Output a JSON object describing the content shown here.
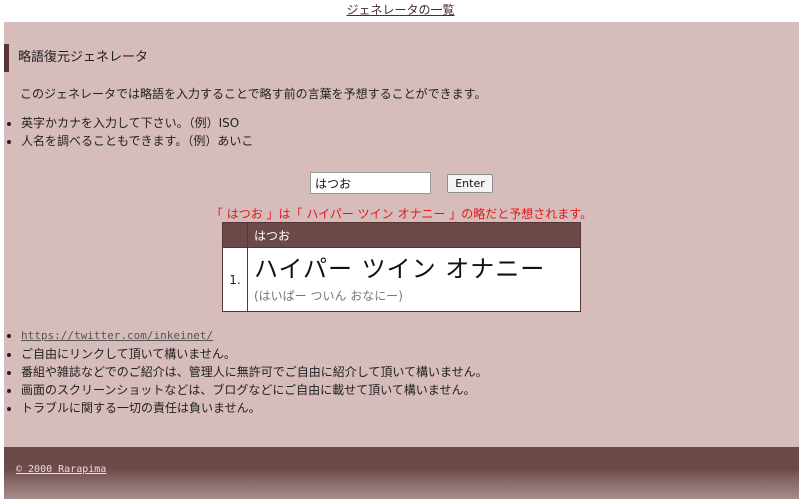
{
  "header": {
    "generator_list_link": "ジェネレータの一覧"
  },
  "page": {
    "title": "略語復元ジェネレータ",
    "intro": "このジェネレータでは略語を入力することで略す前の言葉を予想することができます。",
    "tips": [
      "英字かカナを入力して下さい。（例）ISO",
      "人名を調べることもできます。（例）あいこ"
    ]
  },
  "form": {
    "query_value": "はつお",
    "enter_label": "Enter"
  },
  "result": {
    "message": "「 はつお 」は「 ハイパー ツイン オナニー 」の略だと予想されます。",
    "header_query": "はつお",
    "rows": [
      {
        "rank": "1.",
        "expansion": "ハイパー ツイン オナニー",
        "reading": "(はいぱー ついん おなにー)"
      }
    ]
  },
  "notes": {
    "twitter_link": "https://twitter.com/inkeinet/",
    "items": [
      "ご自由にリンクして頂いて構いません。",
      "番組や雑誌などでのご紹介は、管理人に無許可でご自由に紹介して頂いて構いません。",
      "画面のスクリーンショットなどは、ブログなどにご自由に載せて頂いて構いません。",
      "トラブルに関する一切の責任は負いません。"
    ]
  },
  "footer": {
    "copyright": "© 2000 Rarapima"
  },
  "colors": {
    "content_background": "#d7bcbc",
    "accent_dark": "#5a3434",
    "table_header": "#6d4a4a",
    "message_red": "#e01818"
  }
}
